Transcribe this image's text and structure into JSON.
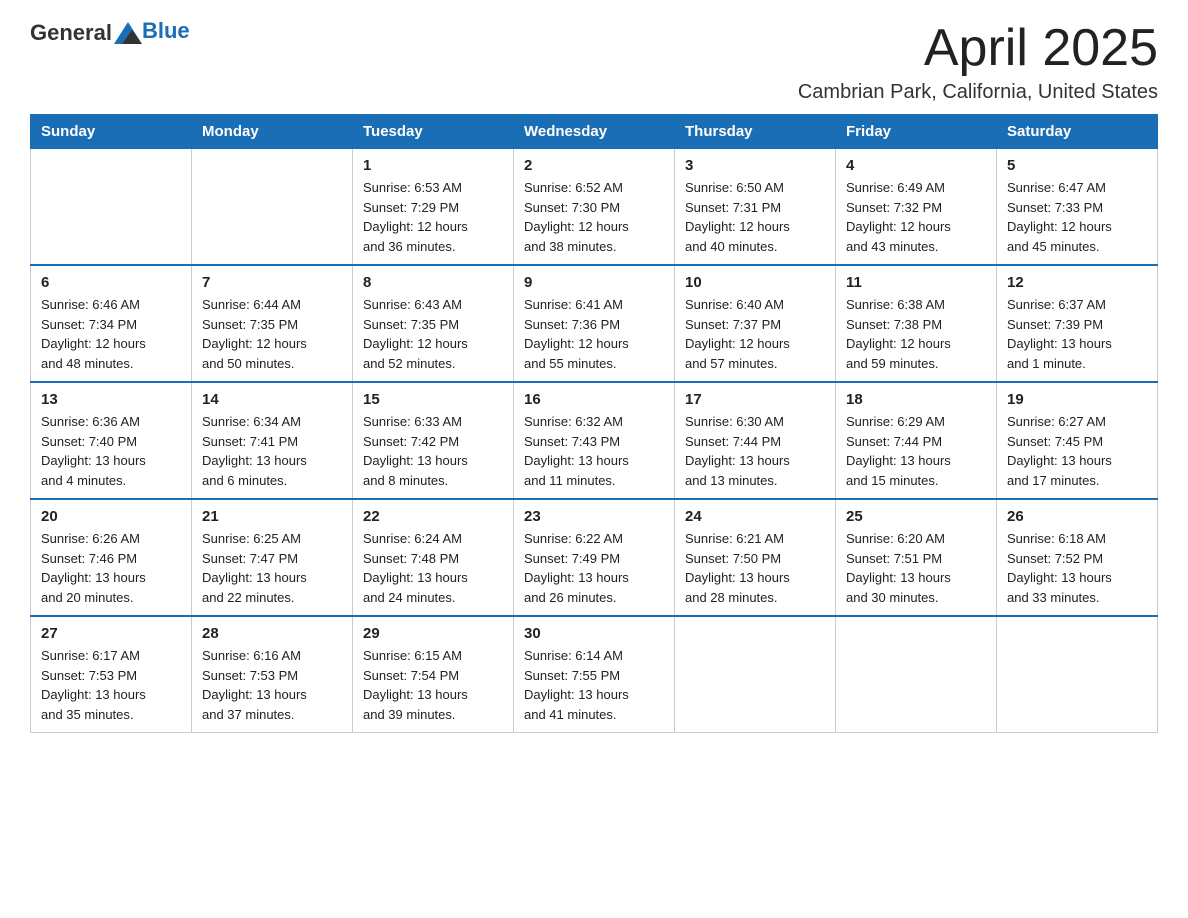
{
  "header": {
    "logo_general": "General",
    "logo_blue": "Blue",
    "month_title": "April 2025",
    "location": "Cambrian Park, California, United States"
  },
  "days_of_week": [
    "Sunday",
    "Monday",
    "Tuesday",
    "Wednesday",
    "Thursday",
    "Friday",
    "Saturday"
  ],
  "weeks": [
    [
      {
        "day": "",
        "info": ""
      },
      {
        "day": "",
        "info": ""
      },
      {
        "day": "1",
        "info": "Sunrise: 6:53 AM\nSunset: 7:29 PM\nDaylight: 12 hours\nand 36 minutes."
      },
      {
        "day": "2",
        "info": "Sunrise: 6:52 AM\nSunset: 7:30 PM\nDaylight: 12 hours\nand 38 minutes."
      },
      {
        "day": "3",
        "info": "Sunrise: 6:50 AM\nSunset: 7:31 PM\nDaylight: 12 hours\nand 40 minutes."
      },
      {
        "day": "4",
        "info": "Sunrise: 6:49 AM\nSunset: 7:32 PM\nDaylight: 12 hours\nand 43 minutes."
      },
      {
        "day": "5",
        "info": "Sunrise: 6:47 AM\nSunset: 7:33 PM\nDaylight: 12 hours\nand 45 minutes."
      }
    ],
    [
      {
        "day": "6",
        "info": "Sunrise: 6:46 AM\nSunset: 7:34 PM\nDaylight: 12 hours\nand 48 minutes."
      },
      {
        "day": "7",
        "info": "Sunrise: 6:44 AM\nSunset: 7:35 PM\nDaylight: 12 hours\nand 50 minutes."
      },
      {
        "day": "8",
        "info": "Sunrise: 6:43 AM\nSunset: 7:35 PM\nDaylight: 12 hours\nand 52 minutes."
      },
      {
        "day": "9",
        "info": "Sunrise: 6:41 AM\nSunset: 7:36 PM\nDaylight: 12 hours\nand 55 minutes."
      },
      {
        "day": "10",
        "info": "Sunrise: 6:40 AM\nSunset: 7:37 PM\nDaylight: 12 hours\nand 57 minutes."
      },
      {
        "day": "11",
        "info": "Sunrise: 6:38 AM\nSunset: 7:38 PM\nDaylight: 12 hours\nand 59 minutes."
      },
      {
        "day": "12",
        "info": "Sunrise: 6:37 AM\nSunset: 7:39 PM\nDaylight: 13 hours\nand 1 minute."
      }
    ],
    [
      {
        "day": "13",
        "info": "Sunrise: 6:36 AM\nSunset: 7:40 PM\nDaylight: 13 hours\nand 4 minutes."
      },
      {
        "day": "14",
        "info": "Sunrise: 6:34 AM\nSunset: 7:41 PM\nDaylight: 13 hours\nand 6 minutes."
      },
      {
        "day": "15",
        "info": "Sunrise: 6:33 AM\nSunset: 7:42 PM\nDaylight: 13 hours\nand 8 minutes."
      },
      {
        "day": "16",
        "info": "Sunrise: 6:32 AM\nSunset: 7:43 PM\nDaylight: 13 hours\nand 11 minutes."
      },
      {
        "day": "17",
        "info": "Sunrise: 6:30 AM\nSunset: 7:44 PM\nDaylight: 13 hours\nand 13 minutes."
      },
      {
        "day": "18",
        "info": "Sunrise: 6:29 AM\nSunset: 7:44 PM\nDaylight: 13 hours\nand 15 minutes."
      },
      {
        "day": "19",
        "info": "Sunrise: 6:27 AM\nSunset: 7:45 PM\nDaylight: 13 hours\nand 17 minutes."
      }
    ],
    [
      {
        "day": "20",
        "info": "Sunrise: 6:26 AM\nSunset: 7:46 PM\nDaylight: 13 hours\nand 20 minutes."
      },
      {
        "day": "21",
        "info": "Sunrise: 6:25 AM\nSunset: 7:47 PM\nDaylight: 13 hours\nand 22 minutes."
      },
      {
        "day": "22",
        "info": "Sunrise: 6:24 AM\nSunset: 7:48 PM\nDaylight: 13 hours\nand 24 minutes."
      },
      {
        "day": "23",
        "info": "Sunrise: 6:22 AM\nSunset: 7:49 PM\nDaylight: 13 hours\nand 26 minutes."
      },
      {
        "day": "24",
        "info": "Sunrise: 6:21 AM\nSunset: 7:50 PM\nDaylight: 13 hours\nand 28 minutes."
      },
      {
        "day": "25",
        "info": "Sunrise: 6:20 AM\nSunset: 7:51 PM\nDaylight: 13 hours\nand 30 minutes."
      },
      {
        "day": "26",
        "info": "Sunrise: 6:18 AM\nSunset: 7:52 PM\nDaylight: 13 hours\nand 33 minutes."
      }
    ],
    [
      {
        "day": "27",
        "info": "Sunrise: 6:17 AM\nSunset: 7:53 PM\nDaylight: 13 hours\nand 35 minutes."
      },
      {
        "day": "28",
        "info": "Sunrise: 6:16 AM\nSunset: 7:53 PM\nDaylight: 13 hours\nand 37 minutes."
      },
      {
        "day": "29",
        "info": "Sunrise: 6:15 AM\nSunset: 7:54 PM\nDaylight: 13 hours\nand 39 minutes."
      },
      {
        "day": "30",
        "info": "Sunrise: 6:14 AM\nSunset: 7:55 PM\nDaylight: 13 hours\nand 41 minutes."
      },
      {
        "day": "",
        "info": ""
      },
      {
        "day": "",
        "info": ""
      },
      {
        "day": "",
        "info": ""
      }
    ]
  ]
}
